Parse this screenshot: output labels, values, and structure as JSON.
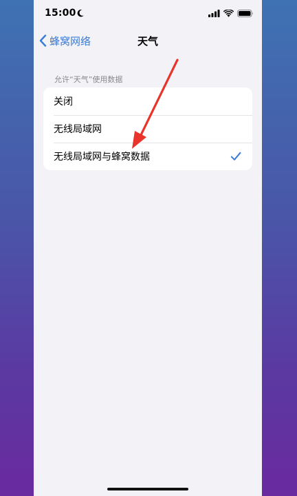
{
  "status_bar": {
    "time": "15:00",
    "icons": [
      "moon-icon",
      "signal-icon",
      "wifi-icon",
      "battery-icon"
    ]
  },
  "nav": {
    "back_label": "蜂窝网络",
    "title": "天气"
  },
  "section": {
    "header": "允许“天气”使用数据",
    "options": [
      {
        "label": "关闭",
        "selected": false
      },
      {
        "label": "无线局域网",
        "selected": false
      },
      {
        "label": "无线局域网与蜂窝数据",
        "selected": true
      }
    ]
  },
  "colors": {
    "accent": "#3a7bd5",
    "background": "#f2f2f7",
    "annotation_arrow": "#e8342a"
  }
}
